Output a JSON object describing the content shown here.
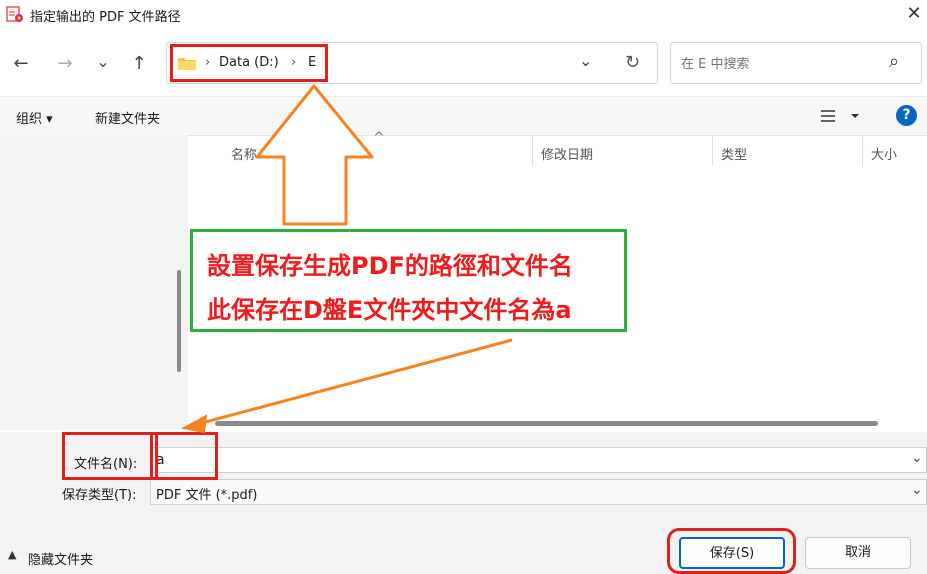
{
  "window": {
    "title": "指定输出的 PDF 文件路径",
    "close_label": "✕"
  },
  "nav": {
    "back_label": "←",
    "forward_label": "→",
    "recent_label": "⌄",
    "up_label": "↑",
    "refresh_label": "↻"
  },
  "address": {
    "segments": [
      "Data (D:)",
      "E"
    ],
    "separator": "›",
    "dropdown_label": "⌄"
  },
  "search": {
    "placeholder": "在 E 中搜索",
    "icon_label": "⌕"
  },
  "toolbar": {
    "organize_label": "组织 ▾",
    "new_folder_label": "新建文件夹",
    "help_label": "?"
  },
  "columns": {
    "name": "名称",
    "modified": "修改日期",
    "type": "类型",
    "size": "大小",
    "sort_indicator": "^"
  },
  "form": {
    "filename_label": "文件名(N):",
    "filename_value": "a",
    "filetype_label": "保存类型(T):",
    "filetype_value": "PDF 文件 (*.pdf)"
  },
  "footer": {
    "hide_folders_label": "隐藏文件夹",
    "save_label": "保存(S)",
    "cancel_label": "取消"
  },
  "annotation": {
    "line1": "設置保存生成PDF的路徑和文件名",
    "line2": "此保存在D盤E文件夾中文件名為a"
  },
  "colors": {
    "accent": "#0067c0",
    "annotation_red": "#ee1c1c",
    "annotation_green": "#2fae3f",
    "arrow_orange": "#f5831f"
  }
}
